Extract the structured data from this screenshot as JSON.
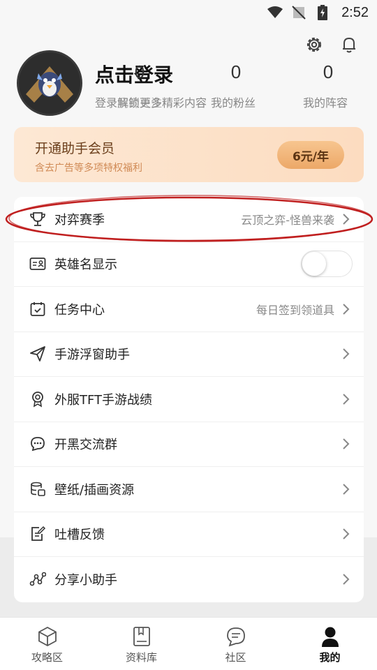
{
  "status_bar": {
    "time": "2:52"
  },
  "profile": {
    "login_title": "点击登录",
    "login_subtitle": "登录解锁更多精彩内容",
    "stats": [
      {
        "value": "0",
        "label": "我的关注"
      },
      {
        "value": "0",
        "label": "我的粉丝"
      },
      {
        "value": "0",
        "label": "我的阵容"
      }
    ]
  },
  "vip": {
    "title": "开通助手会员",
    "subtitle": "含去广告等多项特权福利",
    "price": "6元/年"
  },
  "menu": {
    "items": [
      {
        "label": "对弈赛季",
        "value": "云顶之弈-怪兽来袭",
        "icon": "trophy-icon"
      },
      {
        "label": "英雄名显示",
        "toggle": false,
        "icon": "id-card-icon"
      },
      {
        "label": "任务中心",
        "value": "每日签到领道具",
        "icon": "calendar-icon"
      },
      {
        "label": "手游浮窗助手",
        "icon": "paper-plane-icon"
      },
      {
        "label": "外服TFT手游战绩",
        "icon": "award-medal-icon"
      },
      {
        "label": "开黑交流群",
        "icon": "chat-bubble-icon"
      },
      {
        "label": "壁纸/插画资源",
        "icon": "database-icon"
      },
      {
        "label": "吐槽反馈",
        "icon": "feedback-note-icon"
      },
      {
        "label": "分享小助手",
        "icon": "share-nodes-icon"
      }
    ]
  },
  "bottom_nav": {
    "items": [
      {
        "label": "攻略区",
        "icon": "cube-icon",
        "active": false
      },
      {
        "label": "资料库",
        "icon": "book-icon",
        "active": false
      },
      {
        "label": "社区",
        "icon": "chat-icon",
        "active": false
      },
      {
        "label": "我的",
        "icon": "person-icon",
        "active": true
      }
    ]
  },
  "colors": {
    "vip_bg": "#fde8d4",
    "vip_button": "#f0b274",
    "highlight": "#c01f1f"
  }
}
